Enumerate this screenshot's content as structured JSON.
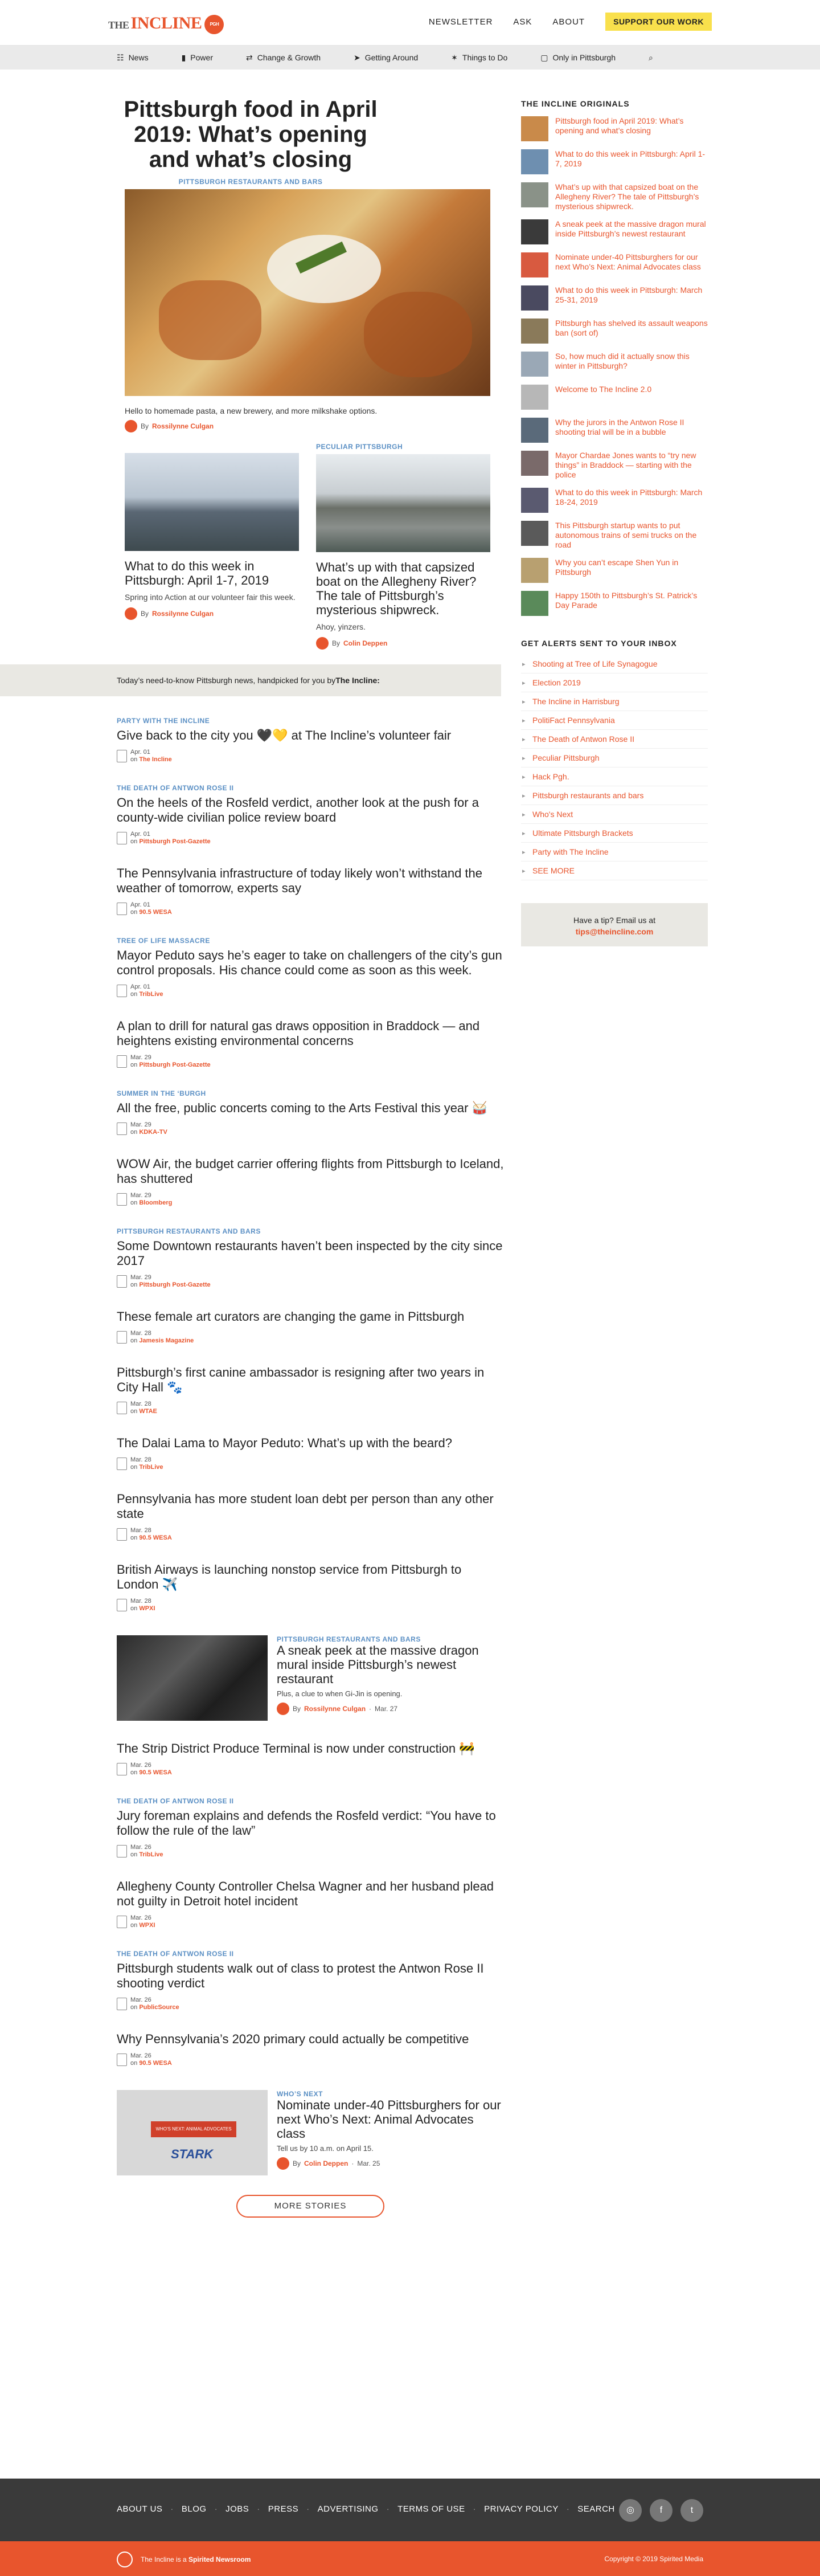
{
  "header": {
    "logo_the": "THE",
    "logo_word": "INCLINE",
    "logo_badge": "PGH",
    "nav": [
      "NEWSLETTER",
      "ASK",
      "ABOUT"
    ],
    "support": "SUPPORT OUR WORK"
  },
  "subnav": [
    {
      "icon": "☷",
      "label": "News"
    },
    {
      "icon": "▮",
      "label": "Power"
    },
    {
      "icon": "⇄",
      "label": "Change & Growth"
    },
    {
      "icon": "➤",
      "label": "Getting Around"
    },
    {
      "icon": "✶",
      "label": "Things to Do"
    },
    {
      "icon": "▢",
      "label": "Only in Pittsburgh"
    },
    {
      "icon": "⌕",
      "label": ""
    }
  ],
  "featured": {
    "title": "Pittsburgh food in April 2019: What’s opening and what’s closing",
    "kicker": "PITTSBURGH RESTAURANTS AND BARS",
    "dek": "Hello to homemade pasta, a new brewery, and more milkshake options.",
    "by": "By",
    "author": "Rossilynne Culgan"
  },
  "cards": [
    {
      "kicker": "",
      "title": "What to do this week in Pittsburgh: April 1-7, 2019",
      "dek": "Spring into Action at our volunteer fair this week.",
      "by": "By",
      "author": "Rossilynne Culgan"
    },
    {
      "kicker": "PECULIAR PITTSBURGH",
      "title": "What’s up with that capsized boat on the Allegheny River? The tale of Pittsburgh’s mysterious shipwreck.",
      "dek": "Ahoy, yinzers.",
      "by": "By",
      "author": "Colin Deppen"
    }
  ],
  "band": {
    "text": "Today’s need-to-know Pittsburgh news, handpicked for you by ",
    "bold": "The Incline:"
  },
  "news": [
    {
      "kicker": "PARTY WITH THE INCLINE",
      "title": "Give back to the city you 🖤💛 at The Incline’s volunteer fair",
      "date": "Apr. 01",
      "on": "on",
      "src": "The Incline"
    },
    {
      "kicker": "THE DEATH OF ANTWON ROSE II",
      "title": "On the heels of the Rosfeld verdict, another look at the push for a county-wide civilian police review board",
      "date": "Apr. 01",
      "on": "on",
      "src": "Pittsburgh Post-Gazette"
    },
    {
      "kicker": "",
      "title": "The Pennsylvania infrastructure of today likely won’t withstand the weather of tomorrow, experts say",
      "date": "Apr. 01",
      "on": "on",
      "src": "90.5 WESA"
    },
    {
      "kicker": "TREE OF LIFE MASSACRE",
      "title": "Mayor Peduto says he’s eager to take on challengers of the city’s gun control proposals. His chance could come as soon as this week.",
      "date": "Apr. 01",
      "on": "on",
      "src": "TribLive"
    },
    {
      "kicker": "",
      "title": "A plan to drill for natural gas draws opposition in Braddock — and heightens existing environmental concerns",
      "date": "Mar. 29",
      "on": "on",
      "src": "Pittsburgh Post-Gazette"
    },
    {
      "kicker": "SUMMER IN THE ‘BURGH",
      "title": "All the free, public concerts coming to the Arts Festival this year 🥁",
      "date": "Mar. 29",
      "on": "on",
      "src": "KDKA-TV"
    },
    {
      "kicker": "",
      "title": "WOW Air, the budget carrier offering flights from Pittsburgh to Iceland, has shuttered",
      "date": "Mar. 29",
      "on": "on",
      "src": "Bloomberg"
    },
    {
      "kicker": "PITTSBURGH RESTAURANTS AND BARS",
      "title": "Some Downtown restaurants haven’t been inspected by the city since 2017",
      "date": "Mar. 29",
      "on": "on",
      "src": "Pittsburgh Post-Gazette"
    },
    {
      "kicker": "",
      "title": "These female art curators are changing the game in Pittsburgh",
      "date": "Mar. 28",
      "on": "on",
      "src": "Jamesis Magazine"
    },
    {
      "kicker": "",
      "title": "Pittsburgh’s first canine ambassador is resigning after two years in City Hall 🐾",
      "date": "Mar. 28",
      "on": "on",
      "src": "WTAE"
    },
    {
      "kicker": "",
      "title": "The Dalai Lama to Mayor Peduto: What’s up with the beard?",
      "date": "Mar. 28",
      "on": "on",
      "src": "TribLive"
    },
    {
      "kicker": "",
      "title": "Pennsylvania has more student loan debt per person than any other state",
      "date": "Mar. 28",
      "on": "on",
      "src": "90.5 WESA"
    },
    {
      "kicker": "",
      "title": "British Airways is launching nonstop service from Pittsburgh to London ✈️",
      "date": "Mar. 28",
      "on": "on",
      "src": "WPXI"
    }
  ],
  "promo1": {
    "kicker": "PITTSBURGH RESTAURANTS AND BARS",
    "title": "A sneak peek at the massive dragon mural inside Pittsburgh’s newest restaurant",
    "dek": "Plus, a clue to when Gi-Jin is opening.",
    "by": "By",
    "author": "Rossilynne Culgan",
    "date": "Mar. 27"
  },
  "news2": [
    {
      "kicker": "",
      "title": "The Strip District Produce Terminal is now under construction 🚧",
      "date": "Mar. 26",
      "on": "on",
      "src": "90.5 WESA"
    },
    {
      "kicker": "THE DEATH OF ANTWON ROSE II",
      "title": "Jury foreman explains and defends the Rosfeld verdict: “You have to follow the rule of the law”",
      "date": "Mar. 26",
      "on": "on",
      "src": "TribLive"
    },
    {
      "kicker": "",
      "title": "Allegheny County Controller Chelsa Wagner and her husband plead not guilty in Detroit hotel incident",
      "date": "Mar. 26",
      "on": "on",
      "src": "WPXI"
    },
    {
      "kicker": "THE DEATH OF ANTWON ROSE II",
      "title": "Pittsburgh students walk out of class to protest the Antwon Rose II shooting verdict",
      "date": "Mar. 26",
      "on": "on",
      "src": "PublicSource"
    },
    {
      "kicker": "",
      "title": "Why Pennsylvania’s 2020 primary could actually be competitive",
      "date": "Mar. 26",
      "on": "on",
      "src": "90.5 WESA"
    }
  ],
  "promo2": {
    "kicker": "WHO’S NEXT",
    "title": "Nominate under-40 Pittsburghers for our next Who’s Next: Animal Advocates class",
    "dek": "Tell us by 10 a.m. on April 15.",
    "by": "By",
    "author": "Colin Deppen",
    "date": "Mar. 25",
    "ribbon": "WHO'S NEXT: ANIMAL ADVOCATES",
    "logo": "STARK"
  },
  "more": "MORE STORIES",
  "originals": {
    "heading": "THE INCLINE ORIGINALS",
    "items": [
      "Pittsburgh food in April 2019: What’s opening and what’s closing",
      "What to do this week in Pittsburgh: April 1-7, 2019",
      "What’s up with that capsized boat on the Allegheny River? The tale of Pittsburgh’s mysterious shipwreck.",
      "A sneak peek at the massive dragon mural inside Pittsburgh’s newest restaurant",
      "Nominate under-40 Pittsburghers for our next Who’s Next: Animal Advocates class",
      "What to do this week in Pittsburgh: March 25-31, 2019",
      "Pittsburgh has shelved its assault weapons ban (sort of)",
      "So, how much did it actually snow this winter in Pittsburgh?",
      "Welcome to The Incline 2.0",
      "Why the jurors in the Antwon Rose II shooting trial will be in a bubble",
      "Mayor Chardae Jones wants to “try new things” in Braddock — starting with the police",
      "What to do this week in Pittsburgh: March 18-24, 2019",
      "This Pittsburgh startup wants to put autonomous trains of semi trucks on the road",
      "Why you can’t escape Shen Yun in Pittsburgh",
      "Happy 150th to Pittsburgh’s St. Patrick’s Day Parade"
    ]
  },
  "alerts": {
    "heading": "GET ALERTS SENT TO YOUR INBOX",
    "items": [
      "Shooting at Tree of Life Synagogue",
      "Election 2019",
      "The Incline in Harrisburg",
      "PolitiFact Pennsylvania",
      "The Death of Antwon Rose II",
      "Peculiar Pittsburgh",
      "Hack Pgh.",
      "Pittsburgh restaurants and bars",
      "Who's Next",
      "Ultimate Pittsburgh Brackets",
      "Party with The Incline",
      "SEE MORE"
    ]
  },
  "tip": {
    "line1": "Have a tip? Email us at",
    "email": "tips@theincline.com"
  },
  "footer": {
    "links": [
      "ABOUT US",
      "BLOG",
      "JOBS",
      "PRESS",
      "ADVERTISING",
      "TERMS OF USE",
      "PRIVACY POLICY",
      "SEARCH"
    ],
    "social": [
      "◎",
      "f",
      "t"
    ],
    "bar_left": "The Incline is a ",
    "bar_brand": "Spirited Newsroom",
    "copyright": "Copyright © 2019 Spirited Media"
  }
}
